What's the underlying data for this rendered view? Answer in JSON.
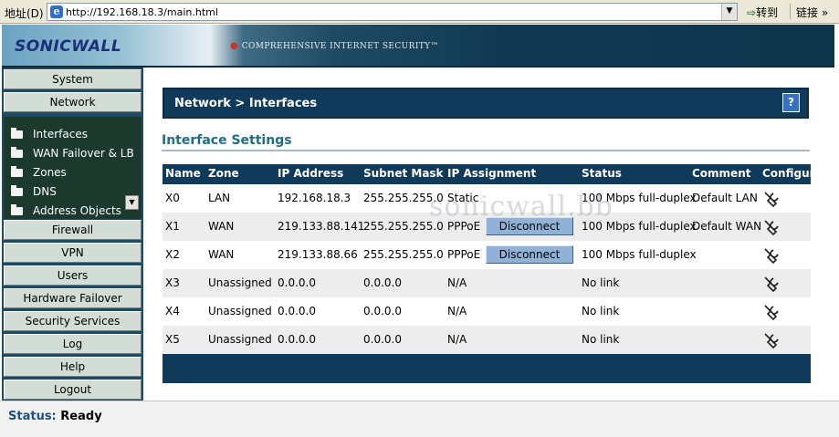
{
  "browser": {
    "address_label": "地址(D)",
    "url": "http://192.168.18.3/main.html",
    "go_label": "转到",
    "links_label": "链接"
  },
  "header": {
    "logo": "SONICWALL",
    "tagline": "COMPREHENSIVE INTERNET SECURITY™"
  },
  "sidebar": {
    "top_items": [
      {
        "label": "System"
      },
      {
        "label": "Network"
      }
    ],
    "sub_items": [
      {
        "label": "Interfaces"
      },
      {
        "label": "WAN Failover & LB"
      },
      {
        "label": "Zones"
      },
      {
        "label": "DNS"
      },
      {
        "label": "Address Objects"
      }
    ],
    "bottom_items": [
      {
        "label": "Firewall"
      },
      {
        "label": "VPN"
      },
      {
        "label": "Users"
      },
      {
        "label": "Hardware Failover"
      },
      {
        "label": "Security Services"
      },
      {
        "label": "Log"
      },
      {
        "label": "Help"
      },
      {
        "label": "Logout"
      }
    ]
  },
  "main": {
    "breadcrumb": "Network > Interfaces",
    "help_label": "?",
    "section_title": "Interface Settings",
    "table": {
      "headers": [
        "Name",
        "Zone",
        "IP Address",
        "Subnet Mask",
        "IP Assignment",
        "Status",
        "Comment",
        "Configure"
      ],
      "rows": [
        {
          "name": "X0",
          "zone": "LAN",
          "ip": "192.168.18.3",
          "mask": "255.255.255.0",
          "assign": "Static",
          "button": "",
          "status": "100 Mbps full-duplex",
          "comment": "Default LAN"
        },
        {
          "name": "X1",
          "zone": "WAN",
          "ip": "219.133.88.141",
          "mask": "255.255.255.0",
          "assign": "PPPoE",
          "button": "Disconnect",
          "status": "100 Mbps full-duplex",
          "comment": "Default WAN"
        },
        {
          "name": "X2",
          "zone": "WAN",
          "ip": "219.133.88.66",
          "mask": "255.255.255.0",
          "assign": "PPPoE",
          "button": "Disconnect",
          "status": "100 Mbps full-duplex",
          "comment": ""
        },
        {
          "name": "X3",
          "zone": "Unassigned",
          "ip": "0.0.0.0",
          "mask": "0.0.0.0",
          "assign": "N/A",
          "button": "",
          "status": "No link",
          "comment": ""
        },
        {
          "name": "X4",
          "zone": "Unassigned",
          "ip": "0.0.0.0",
          "mask": "0.0.0.0",
          "assign": "N/A",
          "button": "",
          "status": "No link",
          "comment": ""
        },
        {
          "name": "X5",
          "zone": "Unassigned",
          "ip": "0.0.0.0",
          "mask": "0.0.0.0",
          "assign": "N/A",
          "button": "",
          "status": "No link",
          "comment": ""
        }
      ]
    },
    "watermark": "sonicwall.bb"
  },
  "status_bar": {
    "label": "Status:",
    "value": "Ready"
  }
}
